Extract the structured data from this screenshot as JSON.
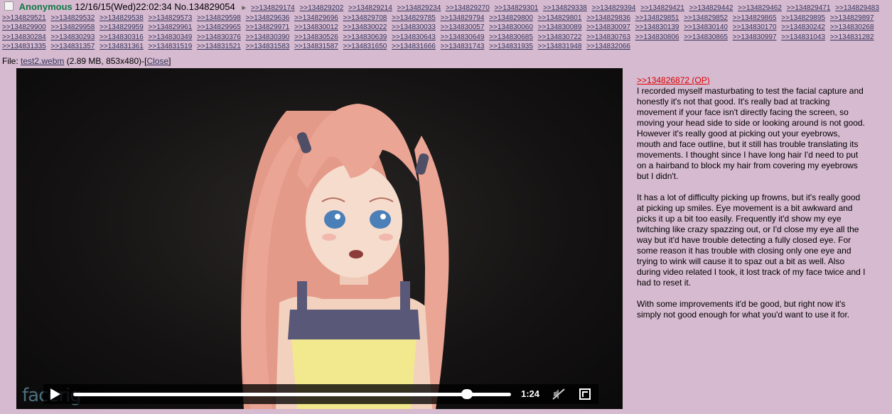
{
  "post": {
    "name": "Anonymous",
    "date": "12/16/15(Wed)22:02:34",
    "number": "No.134829054",
    "arrow": "►"
  },
  "backlinks": [
    ">>134829174",
    ">>134829202",
    ">>134829214",
    ">>134829234",
    ">>134829270",
    ">>134829301",
    ">>134829338",
    ">>134829394",
    ">>134829421",
    ">>134829442",
    ">>134829462",
    ">>134829471",
    ">>134829483",
    ">>134829521",
    ">>134829532",
    ">>134829538",
    ">>134829573",
    ">>134829598",
    ">>134829636",
    ">>134829696",
    ">>134829708",
    ">>134829785",
    ">>134829794",
    ">>134829800",
    ">>134829801",
    ">>134829836",
    ">>134829851",
    ">>134829852",
    ">>134829865",
    ">>134829895",
    ">>134829897",
    ">>134829900",
    ">>134829958",
    ">>134829959",
    ">>134829961",
    ">>134829965",
    ">>134829971",
    ">>134830012",
    ">>134830022",
    ">>134830033",
    ">>134830057",
    ">>134830060",
    ">>134830089",
    ">>134830097",
    ">>134830139",
    ">>134830140",
    ">>134830170",
    ">>134830242",
    ">>134830268",
    ">>134830284",
    ">>134830293",
    ">>134830316",
    ">>134830349",
    ">>134830376",
    ">>134830390",
    ">>134830526",
    ">>134830639",
    ">>134830643",
    ">>134830649",
    ">>134830685",
    ">>134830722",
    ">>134830763",
    ">>134830806",
    ">>134830865",
    ">>134830997",
    ">>134831043",
    ">>134831282",
    ">>134831335",
    ">>134831357",
    ">>134831361",
    ">>134831519",
    ">>134831521",
    ">>134831583",
    ">>134831587",
    ">>134831650",
    ">>134831666",
    ">>134831743",
    ">>134831935",
    ">>134831948",
    ">>134832066"
  ],
  "file": {
    "label": "File:",
    "name": "test2.webm",
    "info": "(2.89 MB, 853x480)-",
    "close_open": "[",
    "close": "Close",
    "close_end": "]"
  },
  "video": {
    "watermark": "facerig",
    "time": "1:24",
    "progress": 0.9
  },
  "comment": {
    "quote": ">>134826872 (OP)",
    "paragraphs": [
      "I recorded myself masturbating to test the facial capture and honestly it's not that good. It's really bad at tracking movement if your face isn't directly facing the screen, so moving your head side to side or looking around is not good. However it's really good at picking out your eyebrows, mouth and face outline, but it still has trouble translating its movements. I thought since I have long hair I'd need to put on a hairband to block my hair from covering my eyebrows but I didn't.",
      "It has a lot of difficulty picking up frowns, but it's really good at picking up smiles. Eye movement is a bit awkward and picks it up a bit too easily. Frequently it'd show my eye twitching like crazy spazzing out, or I'd close my eye all the way but it'd have trouble detecting a fully closed eye. For some reason it has trouble with closing only one eye and trying to wink will cause it to spaz out a bit as well. Also during video related I took, it lost track of my face twice and I had to reset it.",
      "With some improvements it'd be good, but right now it's simply not good enough for what you'd want to use it for."
    ]
  }
}
